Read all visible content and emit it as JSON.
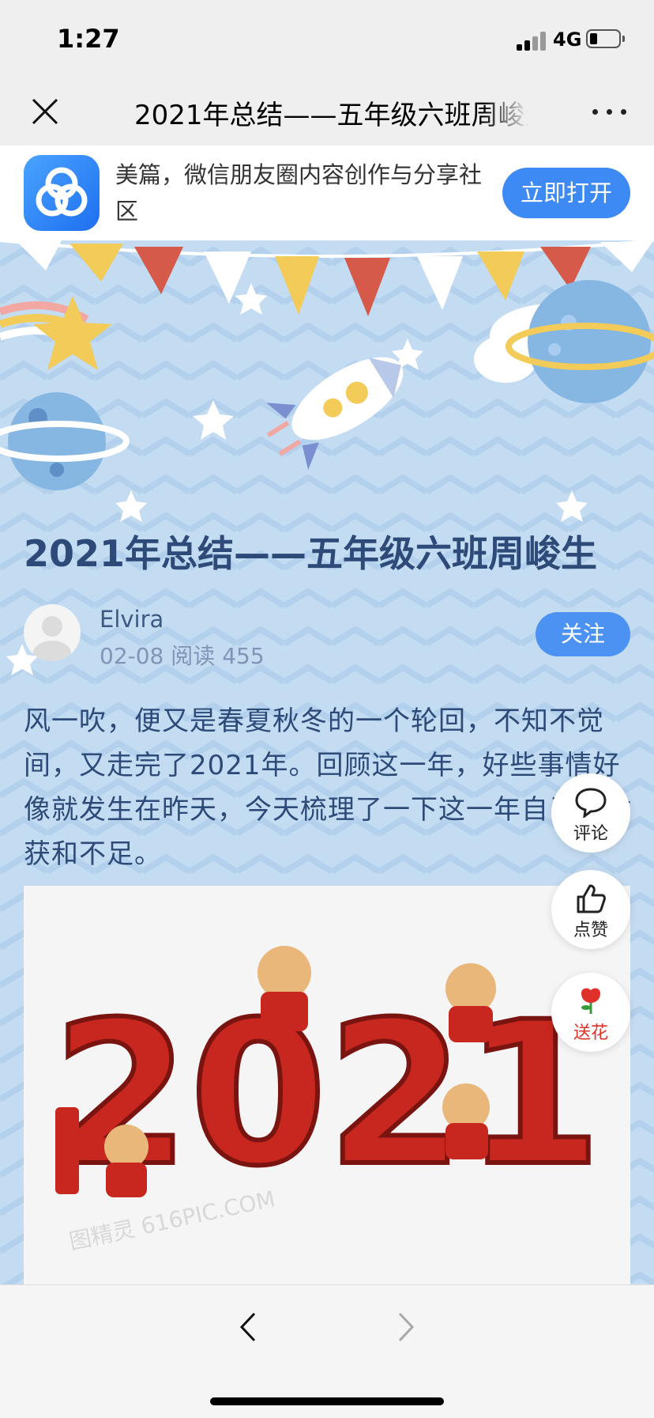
{
  "status_bar": {
    "time": "1:27",
    "network": "4G"
  },
  "nav": {
    "title": "2021年总结——五年级六班周峻生"
  },
  "banner": {
    "app_text": "美篇，微信朋友圈内容创作与分享社区",
    "open_label": "立即打开"
  },
  "article": {
    "title": "2021年总结——五年级六班周峻生",
    "author": "Elvira",
    "date": "02-08",
    "read_label": "阅读",
    "read_count": "455",
    "follow_label": "关注",
    "body": "风一吹，便又是春夏秋冬的一个轮回，不知不觉间，又走完了2021年。回顾这一年，好些事情好像就发生在昨天，今天梳理了一下这一年自己的收获和不足。",
    "image_text": "2021",
    "watermark": "图精灵 616PIC.COM"
  },
  "float_actions": {
    "comment_label": "评论",
    "like_label": "点赞",
    "flower_label": "送花"
  },
  "colors": {
    "title_blue": "#2d4a78",
    "accent": "#4b92f2",
    "background": "#c4dcf2",
    "flower_red": "#e0302a"
  },
  "icons": [
    "close-icon",
    "more-icon",
    "app-logo",
    "comment-icon",
    "thumbs-up-icon",
    "rose-icon",
    "back-arrow-icon",
    "forward-arrow-icon"
  ]
}
